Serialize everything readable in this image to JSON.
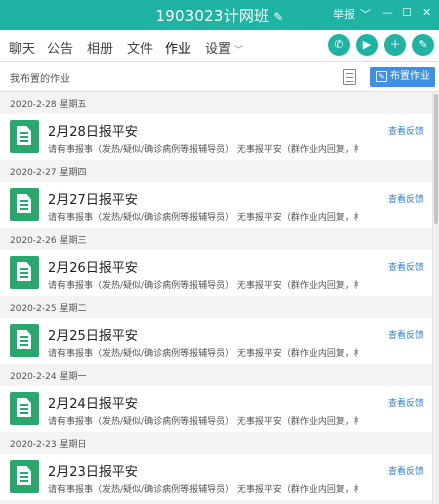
{
  "window": {
    "title": "1903023计网班",
    "edit_icon": "pencil-icon",
    "report_label": "举报",
    "controls": [
      "chevron-down-icon",
      "minimize-icon",
      "maximize-icon",
      "close-icon"
    ]
  },
  "tabs": [
    {
      "label": "聊天"
    },
    {
      "label": "公告"
    },
    {
      "label": "相册"
    },
    {
      "label": "文件"
    },
    {
      "label": "作业",
      "active": true
    },
    {
      "label": "设置"
    }
  ],
  "toolbar_icons": [
    "phone-icon",
    "video-icon",
    "add-app-icon",
    "edit-square-icon"
  ],
  "subbar": {
    "label": "我布置的作业",
    "publish_label": "布置作业"
  },
  "feedback_label": "查看反馈",
  "assignments": [
    {
      "date": "2020-2-28 星期五",
      "title": "2月28日报平安",
      "desc": "请有事报事（发热/疑似/确诊病例等报辅导员） 无事报平安（群作业内回复，格式..."
    },
    {
      "date": "2020-2-27 星期四",
      "title": "2月27日报平安",
      "desc": "请有事报事（发热/疑似/确诊病例等报辅导员） 无事报平安（群作业内回复，格式..."
    },
    {
      "date": "2020-2-26 星期三",
      "title": "2月26日报平安",
      "desc": "请有事报事（发热/疑似/确诊病例等报辅导员） 无事报平安（群作业内回复，格式..."
    },
    {
      "date": "2020-2-25 星期二",
      "title": "2月25日报平安",
      "desc": "请有事报事（发热/疑似/确诊病例等报辅导员） 无事报平安（群作业内回复，格式..."
    },
    {
      "date": "2020-2-24 星期一",
      "title": "2月24日报平安",
      "desc": "请有事报事（发热/疑似/确诊病例等报辅导员） 无事报平安（群作业内回复，格式..."
    },
    {
      "date": "2020-2-23 星期日",
      "title": "2月23日报平安",
      "desc": "请有事报事（发热/疑似/确诊病例等报辅导员） 无事报平安（群作业内回复，格式..."
    }
  ],
  "colors": {
    "titlebar": "#1fb3a3",
    "accent_blue": "#3d8fe8",
    "doc_green": "#28a86d"
  }
}
